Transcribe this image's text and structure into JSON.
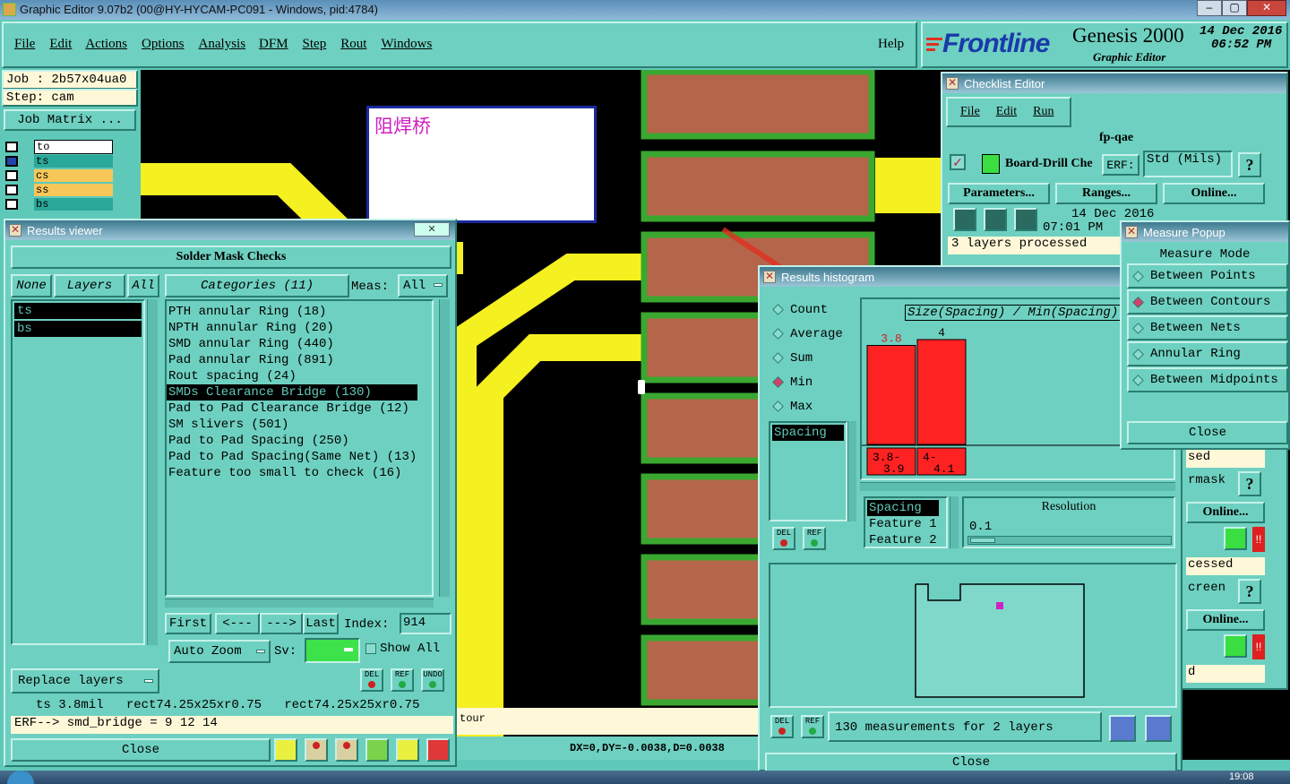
{
  "window": {
    "title": "Graphic Editor 9.07b2 (00@HY-HYCAM-PC091 - Windows, pid:4784)",
    "controls": [
      "–",
      "▢",
      "✕"
    ]
  },
  "menu": {
    "items": [
      "File",
      "Edit",
      "Actions",
      "Options",
      "Analysis",
      "DFM",
      "Step",
      "Rout",
      "Windows"
    ],
    "help": "Help"
  },
  "brand": {
    "logo": "Frontline",
    "product": "Genesis 2000",
    "subtitle": "Graphic Editor",
    "date": "14 Dec 2016",
    "time": "06:52 PM"
  },
  "job": {
    "job_label": "Job : 2b57x04ua0",
    "step_label": "Step: cam",
    "matrix_button": "Job Matrix ..."
  },
  "layers": [
    {
      "name": "to",
      "color": "#ffffff"
    },
    {
      "name": "ts",
      "color": "#2aa89a"
    },
    {
      "name": "cs",
      "color": "#f7c75a"
    },
    {
      "name": "ss",
      "color": "#f7c75a"
    },
    {
      "name": "bs",
      "color": "#2aa89a"
    }
  ],
  "canvas": {
    "annotation": "阻焊桥",
    "partial_label": "tour",
    "delta": "DX=0,DY=-0.0038,D=0.0038"
  },
  "results_viewer": {
    "title": "Results viewer",
    "header": "Solder Mask Checks",
    "none_btn": "None",
    "layers_btn": "Layers",
    "all_btn": "All",
    "layer_list": [
      "ts",
      "bs"
    ],
    "categories_btn": "Categories (11)",
    "meas_label": "Meas:",
    "meas_value": "All",
    "categories": [
      "PTH annular Ring (18)",
      "NPTH annular Ring (20)",
      "SMD annular Ring (440)",
      "Pad annular Ring (891)",
      "Rout spacing (24)",
      "SMDs Clearance Bridge (130)",
      "Pad to Pad Clearance Bridge (12)",
      "SM slivers (501)",
      "Pad to Pad Spacing (250)",
      "Pad to Pad Spacing(Same Net) (13)",
      "Feature too small to check (16)"
    ],
    "selected_category": "SMDs Clearance Bridge (130)",
    "nav": {
      "first": "First",
      "prev": "<---",
      "next": "--->",
      "last": "Last",
      "index_label": "Index:",
      "index_value": "914"
    },
    "auto_zoom": "Auto Zoom",
    "sv_label": "Sv:",
    "show_all": "Show All",
    "replace_layers": "Replace layers",
    "status1": "ts 3.8mil   rect74.25x25xr0.75   rect74.25x25xr0.75",
    "status2": "ERF--> smd_bridge = 9 12 14",
    "close": "Close",
    "icons": {
      "del": "DEL",
      "ref": "REF",
      "undo": "UNDO"
    }
  },
  "checklist": {
    "title": "Checklist Editor",
    "menu": [
      "File",
      "Edit",
      "Run"
    ],
    "name": "fp-qae",
    "action": "Board-Drill Che",
    "erf_label": "ERF:",
    "erf_value": "Std (Mils)",
    "parameters": "Parameters...",
    "ranges": "Ranges...",
    "online": "Online...",
    "run_date": "14 Dec 2016",
    "run_time": "07:01 PM",
    "processed": "3 layers processed",
    "partial": [
      "sed",
      "rmask",
      "Online...",
      "cessed",
      "creen",
      "Online...",
      "d"
    ],
    "help": "?"
  },
  "histogram": {
    "title": "Results histogram",
    "modes": [
      "Count",
      "Average",
      "Sum",
      "Min",
      "Max"
    ],
    "selected_mode": "Min",
    "attr_list": [
      "Spacing"
    ],
    "chart_title": "Size(Spacing) / Min(Spacing)",
    "resolution_label": "Resolution",
    "resolution_value": "0.1",
    "feature_list": [
      "Spacing",
      "Feature 1",
      "Feature 2"
    ],
    "summary": "130 measurements for 2 layers",
    "close": "Close"
  },
  "chart_data": {
    "type": "bar",
    "title": "Size(Spacing) / Min(Spacing)",
    "categories": [
      "3.8-3.9",
      "4-4.1"
    ],
    "top_labels": [
      "3.8",
      "4"
    ],
    "values": [
      0.85,
      0.9
    ],
    "colors": [
      "#ff2222",
      "#ff2222"
    ]
  },
  "measure": {
    "title": "Measure Popup",
    "mode_label": "Measure Mode",
    "options": [
      "Between Points",
      "Between Contours",
      "Between Nets",
      "Annular Ring",
      "Between Midpoints"
    ],
    "selected": "Between Contours",
    "close": "Close"
  },
  "taskbar": {
    "clock": "19:08"
  }
}
